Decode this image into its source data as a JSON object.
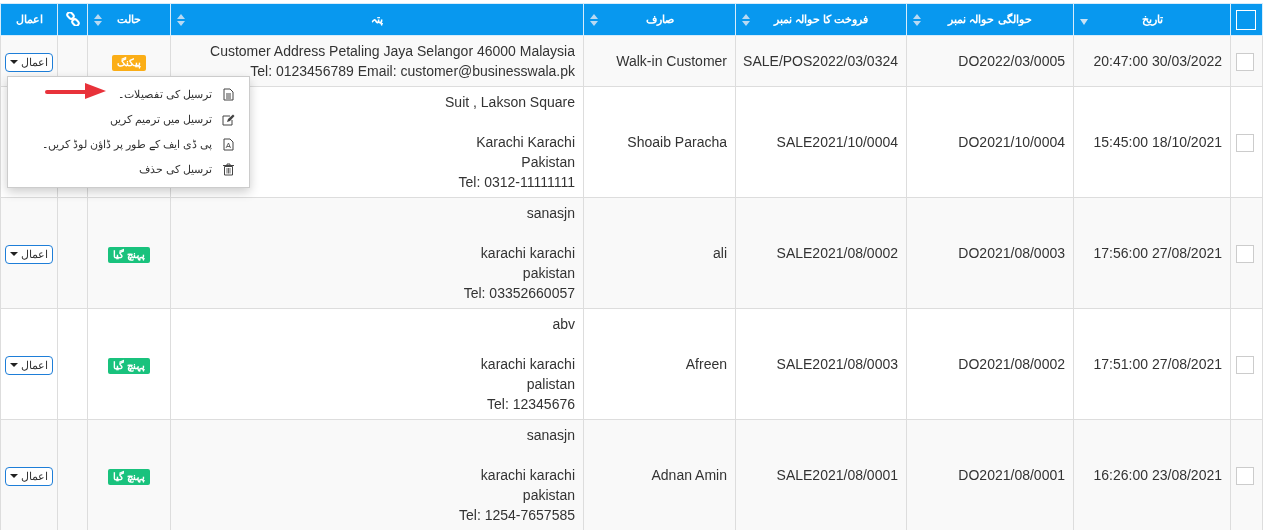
{
  "table": {
    "select_all": {
      "checked": false
    },
    "columns": [
      {
        "kind": "date",
        "label": "تاریخ",
        "sorted": true
      },
      {
        "kind": "text",
        "label": "حوالگی حوالہ نمبر",
        "sorted": false
      },
      {
        "kind": "text",
        "label": "فروخت کا حوالہ نمبر",
        "sorted": false
      },
      {
        "kind": "text",
        "label": "صارف",
        "sorted": false
      },
      {
        "kind": "address",
        "label": "پتہ",
        "sorted": false
      },
      {
        "kind": "status",
        "label": "حالت",
        "sorted": false
      },
      {
        "kind": "link"
      },
      {
        "kind": "actions",
        "label": "اعمال"
      }
    ],
    "rows": [
      {
        "checked": false,
        "date": "20:47:00 30/03/2022",
        "delivery_ref": "DO2022/03/0005",
        "sale_ref": "SALE/POS2022/03/0324",
        "customer": "Walk-in Customer",
        "address": [
          [
            "Customer Address Petaling Jaya Selangor 46000 Malaysia",
            "Tel: 0123456789 Email: customer@businesswala.pk"
          ]
        ],
        "status": {
          "label": "پیکنگ",
          "color": "#fbae17"
        },
        "action": "اعمال"
      },
      {
        "checked": false,
        "date": "15:45:00 18/10/2021",
        "delivery_ref": "DO2021/10/0004",
        "sale_ref": "SALE2021/10/0004",
        "customer": "Shoaib Paracha",
        "address": [
          [
            "Suit , Lakson Square"
          ],
          [
            "Karachi Karachi",
            "Pakistan",
            "Tel: 0312-11111111"
          ]
        ]
      },
      {
        "checked": false,
        "date": "17:56:00 27/08/2021",
        "delivery_ref": "DO2021/08/0003",
        "sale_ref": "SALE2021/08/0002",
        "customer": "ali",
        "address": [
          [
            "sanasjn"
          ],
          [
            "karachi karachi",
            "pakistan",
            "Tel: 03352660057"
          ]
        ],
        "status": {
          "label": "پہنچ گیا",
          "color": "#19c27d"
        },
        "action": "اعمال"
      },
      {
        "checked": false,
        "date": "17:51:00 27/08/2021",
        "delivery_ref": "DO2021/08/0002",
        "sale_ref": "SALE2021/08/0003",
        "customer": "Afreen",
        "address": [
          [
            "abv"
          ],
          [
            "karachi karachi",
            "palistan",
            "Tel: 12345676"
          ]
        ],
        "status": {
          "label": "پہنچ گیا",
          "color": "#19c27d"
        },
        "action": "اعمال"
      },
      {
        "checked": false,
        "date": "16:26:00 23/08/2021",
        "delivery_ref": "DO2021/08/0001",
        "sale_ref": "SALE2021/08/0001",
        "customer": "Adnan Amin",
        "address": [
          [
            "sanasjn"
          ],
          [
            "karachi karachi",
            "pakistan",
            "Tel: 1254-7657585"
          ]
        ],
        "status": {
          "label": "پہنچ گیا",
          "color": "#19c27d"
        },
        "action": "اعمال"
      }
    ]
  },
  "actions_menu": {
    "items": [
      {
        "kind": "details",
        "label": "ترسیل کی تفصیلات۔"
      },
      {
        "kind": "edit",
        "label": "ترسیل میں ترمیم کریں"
      },
      {
        "kind": "pdf",
        "label": "پی ڈی ایف کے طور پر ڈاؤن لوڈ کریں۔"
      },
      {
        "kind": "delete",
        "label": "ترسیل کی حذف"
      }
    ]
  }
}
